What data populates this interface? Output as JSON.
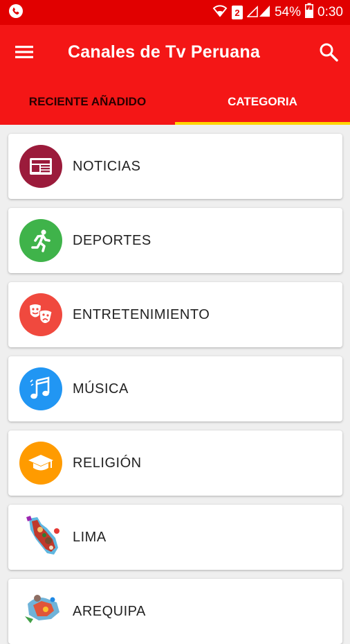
{
  "status_bar": {
    "battery": "54%",
    "time": "0:30",
    "sim_badge": "2"
  },
  "app_bar": {
    "title": "Canales de Tv Peruana",
    "menu_icon": "hamburger-menu-icon",
    "search_icon": "search-icon"
  },
  "tabs": [
    {
      "label": "RECIENTE AÑADIDO",
      "selected": false
    },
    {
      "label": "CATEGORIA",
      "selected": true
    }
  ],
  "colors": {
    "status_bar": "#e10000",
    "app_bar": "#f41616",
    "tab_indicator": "#ffd400"
  },
  "categories": [
    {
      "label": "NOTICIAS",
      "icon": "newspaper-icon",
      "color": "#9b1b3b"
    },
    {
      "label": "DEPORTES",
      "icon": "running-person-icon",
      "color": "#3fb34a"
    },
    {
      "label": "ENTRETENIMIENTO",
      "icon": "theater-masks-icon",
      "color": "#f0493e"
    },
    {
      "label": "MÚSICA",
      "icon": "music-note-icon",
      "color": "#2196f3"
    },
    {
      "label": "RELIGIÓN",
      "icon": "graduation-cap-icon",
      "color": "#ff9b00"
    },
    {
      "label": "LIMA",
      "icon": "lima-map-image",
      "color": ""
    },
    {
      "label": "AREQUIPA",
      "icon": "arequipa-map-image",
      "color": ""
    }
  ]
}
